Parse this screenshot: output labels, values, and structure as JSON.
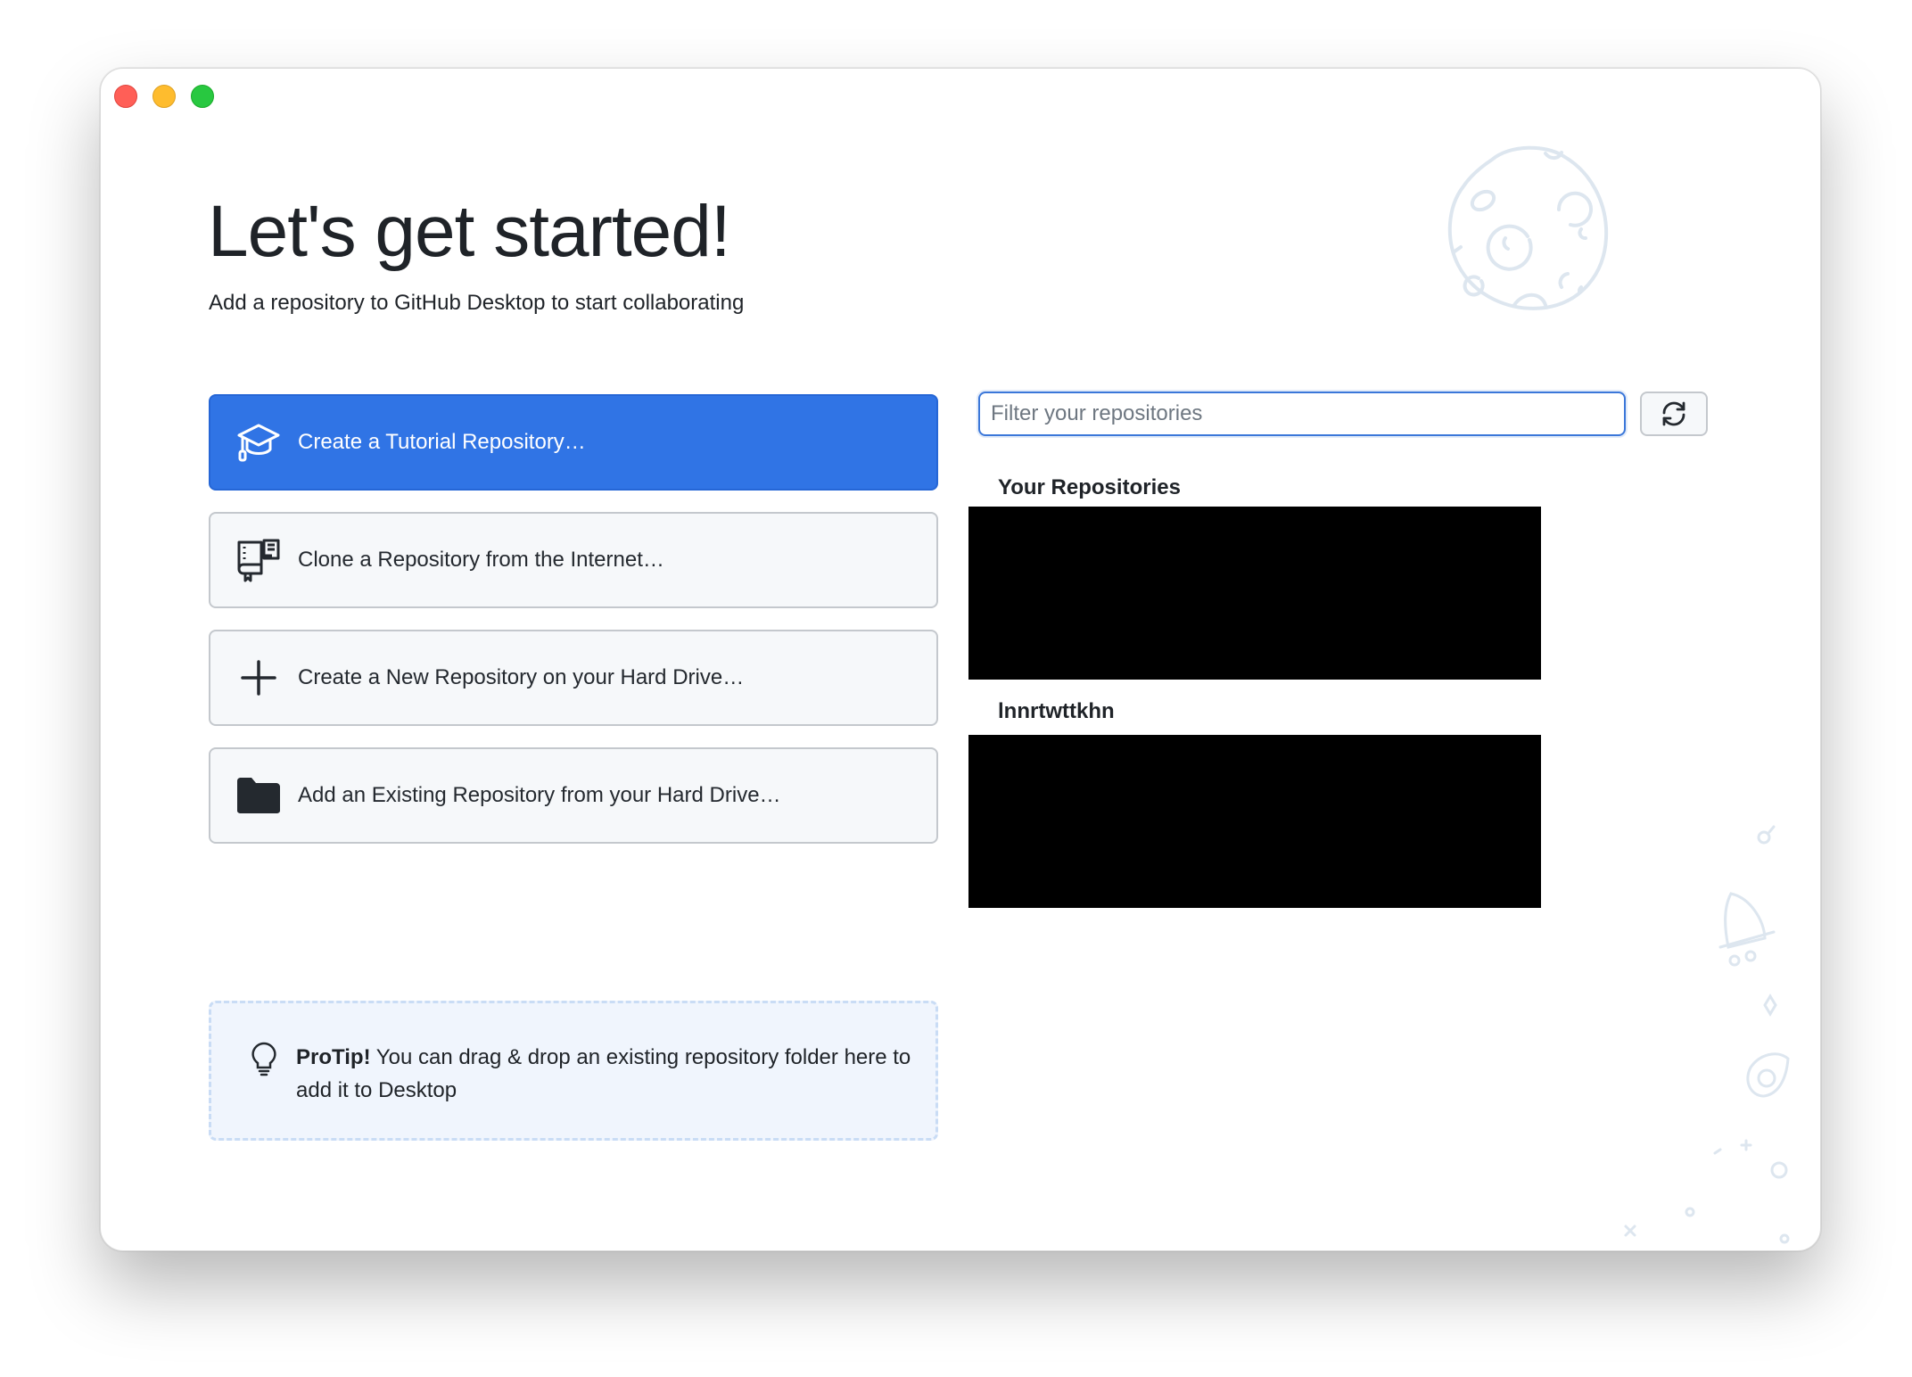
{
  "window": {
    "controls": [
      "close",
      "minimize",
      "maximize"
    ]
  },
  "header": {
    "title": "Let's get started!",
    "subtitle": "Add a repository to GitHub Desktop to start collaborating"
  },
  "actions": [
    {
      "label": "Create a Tutorial Repository…",
      "icon": "mortarboard-icon",
      "primary": true
    },
    {
      "label": "Clone a Repository from the Internet…",
      "icon": "repo-clone-icon",
      "primary": false
    },
    {
      "label": "Create a New Repository on your Hard Drive…",
      "icon": "plus-icon",
      "primary": false
    },
    {
      "label": "Add an Existing Repository from your Hard Drive…",
      "icon": "folder-icon",
      "primary": false
    }
  ],
  "protip": {
    "bold": "ProTip!",
    "text": " You can drag & drop an existing repository folder here to add it to Desktop"
  },
  "repositories": {
    "filter_placeholder": "Filter your repositories",
    "refresh_icon": "sync-icon",
    "groups": [
      {
        "title": "Your Repositories"
      },
      {
        "title": "lnnrtwttkhn"
      }
    ]
  },
  "colors": {
    "primary_button": "#3074e5",
    "focus_border": "#3b77d9",
    "illustration": "#dde6ef"
  }
}
